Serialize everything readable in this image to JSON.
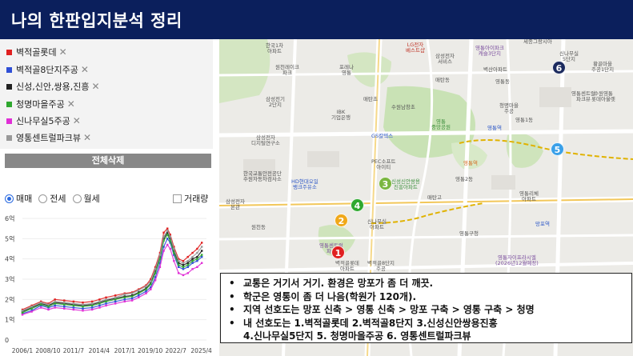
{
  "header": {
    "title": "나의 한판입지분석 정리"
  },
  "complexes": [
    {
      "name": "벽적골롯데",
      "color": "#e02020"
    },
    {
      "name": "벽적골8단지주공",
      "color": "#2f4fd6"
    },
    {
      "name": "신성,신안,쌍용,진흥",
      "color": "#222222"
    },
    {
      "name": "청명마을주공",
      "color": "#2fa82f"
    },
    {
      "name": "신나무실5주공",
      "color": "#e02fd6"
    },
    {
      "name": "영통센트럴파크뷰",
      "color": "#999999"
    }
  ],
  "remove_symbol": "✕",
  "delete_all_label": "전체삭제",
  "filters": {
    "trade_type": [
      {
        "label": "매매",
        "selected": true
      },
      {
        "label": "전세",
        "selected": false
      },
      {
        "label": "월세",
        "selected": false
      }
    ],
    "volume_label": "거래량",
    "volume_checked": false
  },
  "chart_data": {
    "type": "line",
    "title": "",
    "xlabel": "",
    "ylabel": "",
    "ylim": [
      0,
      6
    ],
    "y_ticks": [
      "0",
      "1억",
      "2억",
      "3억",
      "4억",
      "5억",
      "6억"
    ],
    "x_ticks": [
      "2006/1",
      "2008/10",
      "2011/7",
      "2014/4",
      "2017/1",
      "2019/10",
      "2022/7",
      "2025/4"
    ],
    "x": [
      2006.0,
      2007.0,
      2008.0,
      2008.8,
      2009.5,
      2010.5,
      2011.5,
      2012.5,
      2013.5,
      2014.3,
      2015.0,
      2016.0,
      2017.0,
      2017.8,
      2018.5,
      2019.3,
      2019.8,
      2020.3,
      2020.8,
      2021.2,
      2021.6,
      2021.9,
      2022.3,
      2022.8,
      2023.3,
      2023.8,
      2024.3,
      2024.8,
      2025.3
    ],
    "series": [
      {
        "color": "#e02020",
        "values": [
          1.5,
          1.7,
          1.9,
          1.8,
          2.0,
          1.95,
          1.9,
          1.85,
          1.9,
          2.0,
          2.1,
          2.2,
          2.3,
          2.35,
          2.5,
          2.7,
          3.0,
          3.6,
          4.3,
          5.3,
          5.5,
          5.2,
          4.6,
          4.0,
          3.9,
          4.1,
          4.3,
          4.5,
          4.8
        ]
      },
      {
        "color": "#2f4fd6",
        "values": [
          1.3,
          1.45,
          1.7,
          1.6,
          1.7,
          1.65,
          1.6,
          1.55,
          1.6,
          1.7,
          1.8,
          1.9,
          2.0,
          2.05,
          2.2,
          2.4,
          2.6,
          3.1,
          3.8,
          4.6,
          5.0,
          4.8,
          4.2,
          3.6,
          3.5,
          3.6,
          3.8,
          3.9,
          4.1
        ]
      },
      {
        "color": "#222222",
        "values": [
          1.4,
          1.6,
          1.8,
          1.7,
          1.85,
          1.8,
          1.75,
          1.7,
          1.75,
          1.85,
          1.95,
          2.05,
          2.15,
          2.2,
          2.35,
          2.55,
          2.8,
          3.4,
          4.1,
          5.0,
          5.3,
          5.0,
          4.4,
          3.8,
          3.7,
          3.8,
          4.0,
          4.1,
          4.4
        ]
      },
      {
        "color": "#2fa82f",
        "values": [
          1.35,
          1.55,
          1.75,
          1.65,
          1.8,
          1.75,
          1.7,
          1.65,
          1.7,
          1.8,
          1.9,
          2.0,
          2.1,
          2.15,
          2.3,
          2.5,
          2.75,
          3.3,
          4.0,
          4.9,
          5.2,
          4.9,
          4.3,
          3.7,
          3.6,
          3.7,
          3.9,
          4.0,
          4.2
        ]
      },
      {
        "color": "#e02fd6",
        "values": [
          1.25,
          1.4,
          1.6,
          1.5,
          1.6,
          1.55,
          1.5,
          1.45,
          1.5,
          1.6,
          1.7,
          1.8,
          1.9,
          1.95,
          2.1,
          2.3,
          2.5,
          2.95,
          3.6,
          4.4,
          4.7,
          4.5,
          3.9,
          3.3,
          3.2,
          3.3,
          3.5,
          3.6,
          3.8
        ]
      },
      {
        "color": "#999999",
        "values": [
          1.45,
          1.65,
          1.85,
          1.75,
          1.9,
          1.85,
          1.8,
          1.75,
          1.8,
          1.9,
          2.0,
          2.1,
          2.25,
          2.3,
          2.45,
          2.65,
          2.9,
          3.5,
          4.2,
          5.1,
          5.4,
          5.1,
          4.5,
          3.9,
          3.8,
          3.9,
          4.1,
          4.3,
          4.6
        ]
      }
    ]
  },
  "map": {
    "markers": [
      {
        "num": "1",
        "color": "#e02020"
      },
      {
        "num": "2",
        "color": "#f0a81a"
      },
      {
        "num": "3",
        "color": "#7ab640"
      },
      {
        "num": "4",
        "color": "#2fa82f"
      },
      {
        "num": "5",
        "color": "#3aa0e8"
      },
      {
        "num": "6",
        "color": "#1b2a5e"
      }
    ],
    "labels": [
      "한국1차\n아파트",
      "원천레이크\n파크",
      "LG전자\n베스트샵",
      "삼성전자\n서비스",
      "영통아이파크\n캐슬3단지",
      "세종그랑시아",
      "포레나\n영통",
      "매탄동",
      "수원남창초",
      "벽산아파트",
      "영통동",
      "황골마을\n주공1단지",
      "신나무실\n5단지",
      "매탄초",
      "삼성전기\n2단지",
      "영통\n중앙공원",
      "청명마을\n주공",
      "영통역",
      "수원영통\n롯데아울렛",
      "영통센트럴\n파크뷰",
      "IBK\n기업은행",
      "삼성전자\n디지털연구소",
      "GS칼텍스",
      "한국교통안전공단\n수원자동차검사소",
      "PEC소프트\n아이티",
      "신성신안쌍용\n진흥아파트",
      "영통역",
      "HD현대오일\n뱅크주유소",
      "영통2동",
      "매탄고",
      "신나무실\n아파트",
      "영통센트럴\n파크",
      "영통1동",
      "벽적골롯데\n아파트",
      "벽적골8단지\n주공",
      "영통리체\n아파트",
      "망포역",
      "영통구청",
      "영통자이프라시엘\n(2026년12월예정)",
      "삼성전자\n본관",
      "원천동"
    ]
  },
  "notes": [
    {
      "bullet": "•",
      "text": "교통은 거기서 거기. 환경은 망포가 좀 더 깨끗."
    },
    {
      "bullet": "•",
      "text": "학군은 영통이 좀 더 나음(학원가 120개)."
    },
    {
      "bullet": "•",
      "text": "지역 선호도는  망포 신축 > 영통 신축 > 망포 구축 > 영통 구축 > 청명"
    },
    {
      "bullet": "•",
      "text": "내 선호도는 1.벽적골롯데 2.벽적골8단지 3.신성신안쌍용진흥"
    },
    {
      "bullet": "",
      "text": "4.신나무실5단지 5. 청명마을주공 6. 영통센트럴파크뷰"
    }
  ]
}
